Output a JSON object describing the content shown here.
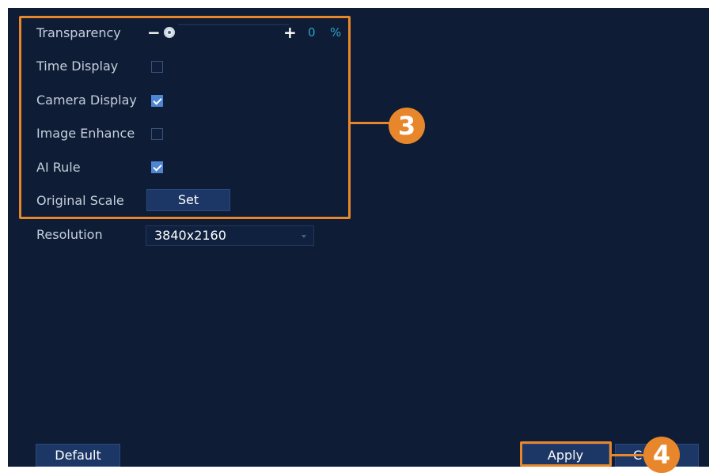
{
  "settings": {
    "transparency": {
      "label": "Transparency",
      "minus": "−",
      "plus": "+",
      "value": "0",
      "unit": "%",
      "level": 0
    },
    "time_display": {
      "label": "Time Display",
      "checked": false
    },
    "camera_display": {
      "label": "Camera Display",
      "checked": true
    },
    "image_enhance": {
      "label": "Image Enhance",
      "checked": false
    },
    "ai_rule": {
      "label": "AI Rule",
      "checked": true
    },
    "original_scale": {
      "label": "Original Scale",
      "button": "Set"
    },
    "resolution": {
      "label": "Resolution",
      "value": "3840x2160"
    }
  },
  "footer": {
    "default_label": "Default",
    "apply_label": "Apply",
    "cancel_label": "C"
  },
  "callouts": {
    "three": "3",
    "four": "4"
  },
  "colors": {
    "background": "#0e1c35",
    "accent": "#e8862c",
    "checkbox_on": "#4d86d3",
    "button": "#1c3765"
  }
}
